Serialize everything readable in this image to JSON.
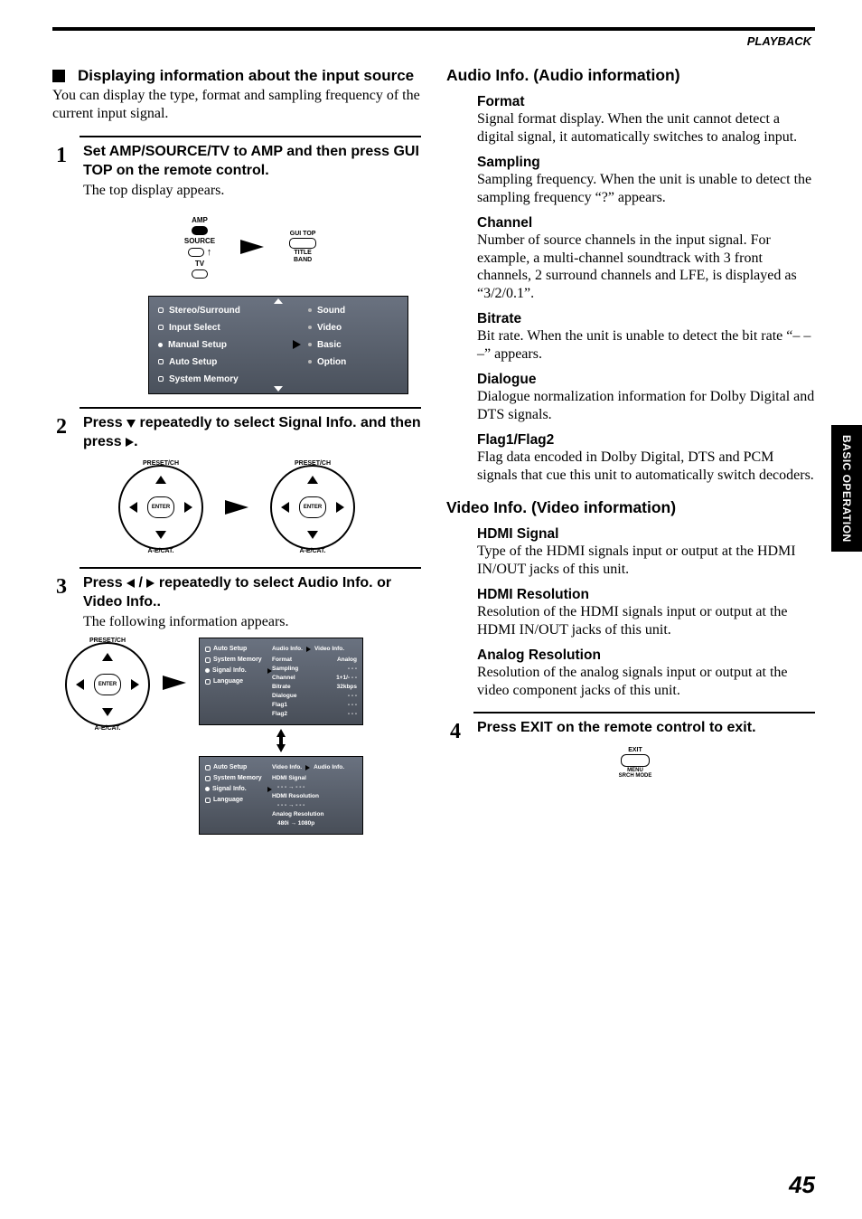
{
  "header": {
    "section": "PLAYBACK"
  },
  "side_tab": "BASIC OPERATION",
  "page_number": "45",
  "left": {
    "section_title": "Displaying information about the input source",
    "section_intro": "You can display the type, format and sampling frequency of the current input signal.",
    "step1": {
      "title": "Set AMP/SOURCE/TV to AMP and then press GUI TOP on the remote control.",
      "desc": "The top display appears.",
      "switch_labels": {
        "amp": "AMP",
        "source": "SOURCE",
        "tv": "TV"
      },
      "button_labels": {
        "gui_top": "GUI TOP",
        "title": "TITLE",
        "band": "BAND"
      }
    },
    "menu": {
      "left": [
        "Stereo/Surround",
        "Input Select",
        "Manual Setup",
        "Auto Setup",
        "System Memory"
      ],
      "right": [
        "Sound",
        "Video",
        "Basic",
        "Option"
      ]
    },
    "step2": {
      "title_a": "Press ",
      "title_b": " repeatedly to select Signal Info. and then press ",
      "title_c": ".",
      "dpad": {
        "top": "PRESET/CH",
        "bottom": "A-E/CAT.",
        "center": "ENTER"
      }
    },
    "step3": {
      "title_a": "Press ",
      "title_b": " / ",
      "title_c": " repeatedly to select Audio Info. or Video Info..",
      "desc": "The following information appears.",
      "panel_menu": [
        "Auto Setup",
        "System Memory",
        "Signal Info.",
        "Language"
      ],
      "audio_panel": {
        "header_left": "Audio Info.",
        "header_right": "Video Info.",
        "rows": [
          {
            "k": "Format",
            "v": "Analog"
          },
          {
            "k": "Sampling",
            "v": "- - -"
          },
          {
            "k": "Channel",
            "v": "1+1/- - -"
          },
          {
            "k": "Bitrate",
            "v": "32kbps"
          },
          {
            "k": "Dialogue",
            "v": "- - -"
          },
          {
            "k": "Flag1",
            "v": "- - -"
          },
          {
            "k": "Flag2",
            "v": "- - -"
          }
        ]
      },
      "video_panel": {
        "header_left": "Video Info.",
        "header_right": "Audio Info.",
        "rows": [
          {
            "k": "HDMI Signal",
            "v": ""
          },
          {
            "k": "- - -  →  - - -",
            "v": ""
          },
          {
            "k": "HDMI Resolution",
            "v": ""
          },
          {
            "k": "- - -  →  - - -",
            "v": ""
          },
          {
            "k": "Analog Resolution",
            "v": ""
          },
          {
            "k": "480i  →  1080p",
            "v": ""
          }
        ]
      }
    }
  },
  "right": {
    "audio_h": "Audio Info. (Audio information)",
    "format_h": "Format",
    "format_p": "Signal format display. When the unit cannot detect a digital signal, it automatically switches to analog input.",
    "sampling_h": "Sampling",
    "sampling_p": "Sampling frequency. When the unit is unable to detect the sampling frequency “?” appears.",
    "channel_h": "Channel",
    "channel_p": "Number of source channels in the input signal. For example, a multi-channel soundtrack with 3 front channels, 2 surround channels and LFE, is displayed as “3/2/0.1”.",
    "bitrate_h": "Bitrate",
    "bitrate_p": "Bit rate. When the unit is unable to detect the bit rate “– – –” appears.",
    "dialogue_h": "Dialogue",
    "dialogue_p": "Dialogue normalization information for Dolby Digital and DTS signals.",
    "flag_h": "Flag1/Flag2",
    "flag_p": "Flag data encoded in Dolby Digital, DTS and PCM signals that cue this unit to automatically switch decoders.",
    "video_h": "Video Info. (Video information)",
    "hdmi_sig_h": "HDMI Signal",
    "hdmi_sig_p": "Type of the HDMI signals input or output at the HDMI IN/OUT jacks of this unit.",
    "hdmi_res_h": "HDMI Resolution",
    "hdmi_res_p": "Resolution of the HDMI signals input or output at the HDMI IN/OUT jacks of this unit.",
    "analog_res_h": "Analog Resolution",
    "analog_res_p": "Resolution of the analog signals input or output at the video component jacks of this unit.",
    "step4_title": "Press EXIT on the remote control to exit.",
    "exit": {
      "top": "EXIT",
      "mid": "MENU",
      "bot": "SRCH MODE"
    }
  }
}
